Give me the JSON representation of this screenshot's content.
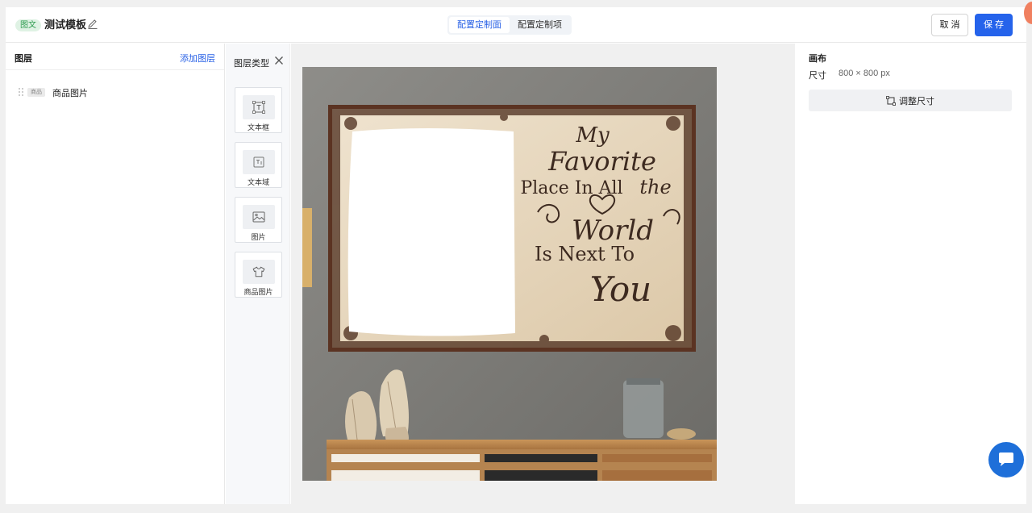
{
  "header": {
    "tag": "图文",
    "title": "测试模板",
    "tabs": [
      {
        "label": "配置定制面",
        "active": true
      },
      {
        "label": "配置定制项",
        "active": false
      }
    ],
    "cancel_label": "取 消",
    "save_label": "保 存"
  },
  "layers_panel": {
    "title": "图层",
    "add_label": "添加图层",
    "items": [
      {
        "tag": "商品",
        "name": "商品图片"
      }
    ]
  },
  "layer_types": {
    "title": "图层类型",
    "items": [
      {
        "label": "文本框",
        "icon": "text-box-icon"
      },
      {
        "label": "文本域",
        "icon": "text-area-icon"
      },
      {
        "label": "图片",
        "icon": "image-icon"
      },
      {
        "label": "商品图片",
        "icon": "tshirt-icon"
      }
    ]
  },
  "canvas": {
    "artwork_lines": [
      "My",
      "Favorite",
      "Place In All",
      "the",
      "World",
      "Is Next To",
      "You"
    ]
  },
  "properties": {
    "title": "画布",
    "size_label": "尺寸",
    "size_value": "800 × 800 px",
    "resize_label": "调整尺寸"
  },
  "colors": {
    "accent": "#2563eb",
    "tag_bg": "#dff2e4",
    "tag_text": "#2a9a4c"
  }
}
